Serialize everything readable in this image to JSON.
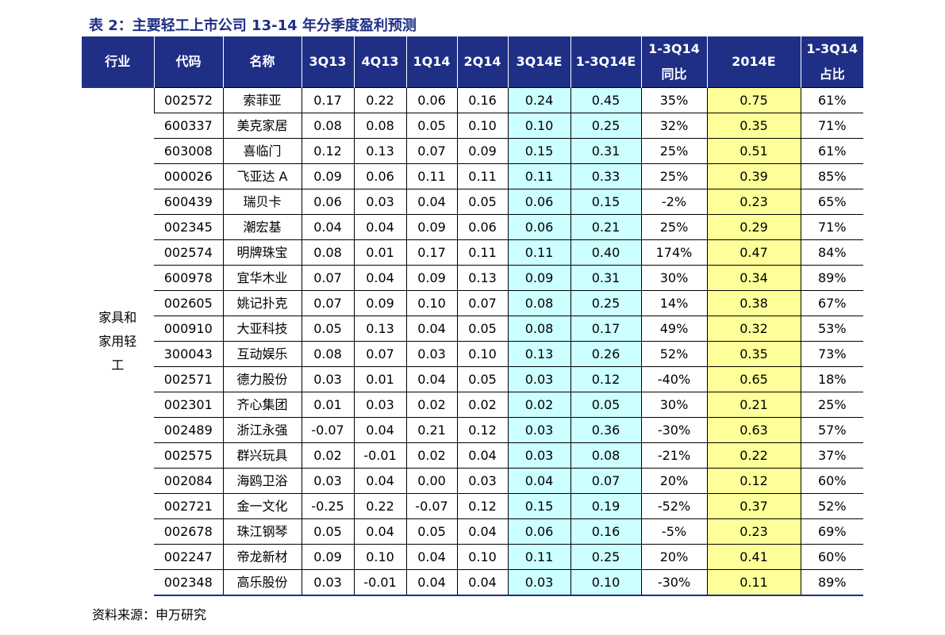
{
  "title": "表 2：主要轻工上市公司 13-14 年分季度盈利预测",
  "headers": {
    "industry": "行业",
    "code": "代码",
    "name": "名称",
    "q3_13": "3Q13",
    "q4_13": "4Q13",
    "q1_14": "1Q14",
    "q2_14": "2Q14",
    "q3_14e": "3Q14E",
    "q1_3_14e": "1-3Q14E",
    "yoy_line1": "1-3Q14",
    "yoy_line2": "同比",
    "y2014e": "2014E",
    "share_line1": "1-3Q14",
    "share_line2": "占比"
  },
  "industry": {
    "line1": "家具和",
    "line2": "家用轻",
    "line3": "工"
  },
  "rows": [
    {
      "code": "002572",
      "name": "索菲亚",
      "q3_13": "0.17",
      "q4_13": "0.22",
      "q1_14": "0.06",
      "q2_14": "0.16",
      "q3_14e": "0.24",
      "q1_3_14e": "0.45",
      "yoy": "35%",
      "y2014e": "0.75",
      "share": "61%"
    },
    {
      "code": "600337",
      "name": "美克家居",
      "q3_13": "0.08",
      "q4_13": "0.08",
      "q1_14": "0.05",
      "q2_14": "0.10",
      "q3_14e": "0.10",
      "q1_3_14e": "0.25",
      "yoy": "32%",
      "y2014e": "0.35",
      "share": "71%"
    },
    {
      "code": "603008",
      "name": "喜临门",
      "q3_13": "0.12",
      "q4_13": "0.13",
      "q1_14": "0.07",
      "q2_14": "0.09",
      "q3_14e": "0.15",
      "q1_3_14e": "0.31",
      "yoy": "25%",
      "y2014e": "0.51",
      "share": "61%"
    },
    {
      "code": "000026",
      "name": "飞亚达 A",
      "q3_13": "0.09",
      "q4_13": "0.06",
      "q1_14": "0.11",
      "q2_14": "0.11",
      "q3_14e": "0.11",
      "q1_3_14e": "0.33",
      "yoy": "25%",
      "y2014e": "0.39",
      "share": "85%"
    },
    {
      "code": "600439",
      "name": "瑞贝卡",
      "q3_13": "0.06",
      "q4_13": "0.03",
      "q1_14": "0.04",
      "q2_14": "0.05",
      "q3_14e": "0.06",
      "q1_3_14e": "0.15",
      "yoy": "-2%",
      "y2014e": "0.23",
      "share": "65%"
    },
    {
      "code": "002345",
      "name": "潮宏基",
      "q3_13": "0.04",
      "q4_13": "0.04",
      "q1_14": "0.09",
      "q2_14": "0.06",
      "q3_14e": "0.06",
      "q1_3_14e": "0.21",
      "yoy": "25%",
      "y2014e": "0.29",
      "share": "71%"
    },
    {
      "code": "002574",
      "name": "明牌珠宝",
      "q3_13": "0.08",
      "q4_13": "0.01",
      "q1_14": "0.17",
      "q2_14": "0.11",
      "q3_14e": "0.11",
      "q1_3_14e": "0.40",
      "yoy": "174%",
      "y2014e": "0.47",
      "share": "84%"
    },
    {
      "code": "600978",
      "name": "宜华木业",
      "q3_13": "0.07",
      "q4_13": "0.04",
      "q1_14": "0.09",
      "q2_14": "0.13",
      "q3_14e": "0.09",
      "q1_3_14e": "0.31",
      "yoy": "30%",
      "y2014e": "0.34",
      "share": "89%"
    },
    {
      "code": "002605",
      "name": "姚记扑克",
      "q3_13": "0.07",
      "q4_13": "0.09",
      "q1_14": "0.10",
      "q2_14": "0.07",
      "q3_14e": "0.08",
      "q1_3_14e": "0.25",
      "yoy": "14%",
      "y2014e": "0.38",
      "share": "67%"
    },
    {
      "code": "000910",
      "name": "大亚科技",
      "q3_13": "0.05",
      "q4_13": "0.13",
      "q1_14": "0.04",
      "q2_14": "0.05",
      "q3_14e": "0.08",
      "q1_3_14e": "0.17",
      "yoy": "49%",
      "y2014e": "0.32",
      "share": "53%"
    },
    {
      "code": "300043",
      "name": "互动娱乐",
      "q3_13": "0.08",
      "q4_13": "0.07",
      "q1_14": "0.03",
      "q2_14": "0.10",
      "q3_14e": "0.13",
      "q1_3_14e": "0.26",
      "yoy": "52%",
      "y2014e": "0.35",
      "share": "73%"
    },
    {
      "code": "002571",
      "name": "德力股份",
      "q3_13": "0.03",
      "q4_13": "0.01",
      "q1_14": "0.04",
      "q2_14": "0.05",
      "q3_14e": "0.03",
      "q1_3_14e": "0.12",
      "yoy": "-40%",
      "y2014e": "0.65",
      "share": "18%"
    },
    {
      "code": "002301",
      "name": "齐心集团",
      "q3_13": "0.01",
      "q4_13": "0.03",
      "q1_14": "0.02",
      "q2_14": "0.02",
      "q3_14e": "0.02",
      "q1_3_14e": "0.05",
      "yoy": "30%",
      "y2014e": "0.21",
      "share": "25%"
    },
    {
      "code": "002489",
      "name": "浙江永强",
      "q3_13": "-0.07",
      "q4_13": "0.04",
      "q1_14": "0.21",
      "q2_14": "0.12",
      "q3_14e": "0.03",
      "q1_3_14e": "0.36",
      "yoy": "-30%",
      "y2014e": "0.63",
      "share": "57%"
    },
    {
      "code": "002575",
      "name": "群兴玩具",
      "q3_13": "0.02",
      "q4_13": "-0.01",
      "q1_14": "0.02",
      "q2_14": "0.04",
      "q3_14e": "0.03",
      "q1_3_14e": "0.08",
      "yoy": "-21%",
      "y2014e": "0.22",
      "share": "37%"
    },
    {
      "code": "002084",
      "name": "海鸥卫浴",
      "q3_13": "0.03",
      "q4_13": "0.04",
      "q1_14": "0.00",
      "q2_14": "0.03",
      "q3_14e": "0.04",
      "q1_3_14e": "0.07",
      "yoy": "20%",
      "y2014e": "0.12",
      "share": "60%"
    },
    {
      "code": "002721",
      "name": "金一文化",
      "q3_13": "-0.25",
      "q4_13": "0.22",
      "q1_14": "-0.07",
      "q2_14": "0.12",
      "q3_14e": "0.15",
      "q1_3_14e": "0.19",
      "yoy": "-52%",
      "y2014e": "0.37",
      "share": "52%"
    },
    {
      "code": "002678",
      "name": "珠江钢琴",
      "q3_13": "0.05",
      "q4_13": "0.04",
      "q1_14": "0.05",
      "q2_14": "0.04",
      "q3_14e": "0.06",
      "q1_3_14e": "0.16",
      "yoy": "-5%",
      "y2014e": "0.23",
      "share": "69%"
    },
    {
      "code": "002247",
      "name": "帝龙新材",
      "q3_13": "0.09",
      "q4_13": "0.10",
      "q1_14": "0.04",
      "q2_14": "0.10",
      "q3_14e": "0.11",
      "q1_3_14e": "0.25",
      "yoy": "20%",
      "y2014e": "0.41",
      "share": "60%"
    },
    {
      "code": "002348",
      "name": "高乐股份",
      "q3_13": "0.03",
      "q4_13": "-0.01",
      "q1_14": "0.04",
      "q2_14": "0.04",
      "q3_14e": "0.03",
      "q1_3_14e": "0.10",
      "yoy": "-30%",
      "y2014e": "0.11",
      "share": "89%"
    }
  ],
  "source": "资料来源：申万研究",
  "colors": {
    "header_bg": "#1f2f86",
    "highlight_cyan": "#ccffff",
    "highlight_yellow": "#ffff99"
  }
}
